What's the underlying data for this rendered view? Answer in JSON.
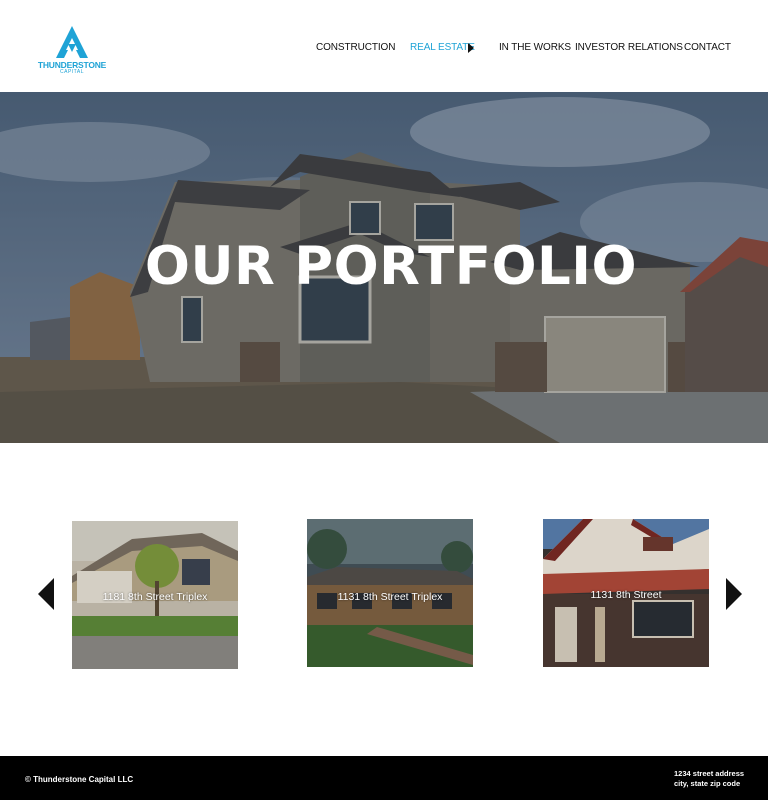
{
  "brand": {
    "name": "THUNDERSTONE",
    "subtitle": "CAPITAL",
    "accent_color": "#1fa3d6"
  },
  "nav": {
    "items": [
      {
        "label": "CONSTRUCTION",
        "active": false
      },
      {
        "label": "REAL ESTATE",
        "active": true,
        "has_submenu": true
      },
      {
        "label": "IN THE WORKS",
        "active": false
      },
      {
        "label": "INVESTOR RELATIONS",
        "active": false
      },
      {
        "label": "CONTACT",
        "active": false
      }
    ]
  },
  "hero": {
    "title": "OUR PORTFOLIO"
  },
  "portfolio": {
    "prev_icon": "triangle-left",
    "next_icon": "triangle-right",
    "items": [
      {
        "label": "1181 8th Street Triplex"
      },
      {
        "label": "1131 8th Street Triplex"
      },
      {
        "label": "1131 8th Street"
      }
    ]
  },
  "footer": {
    "copyright": "© Thunderstone Capital LLC",
    "address_line1": "1234 street address",
    "address_line2": "city, state zip code"
  }
}
